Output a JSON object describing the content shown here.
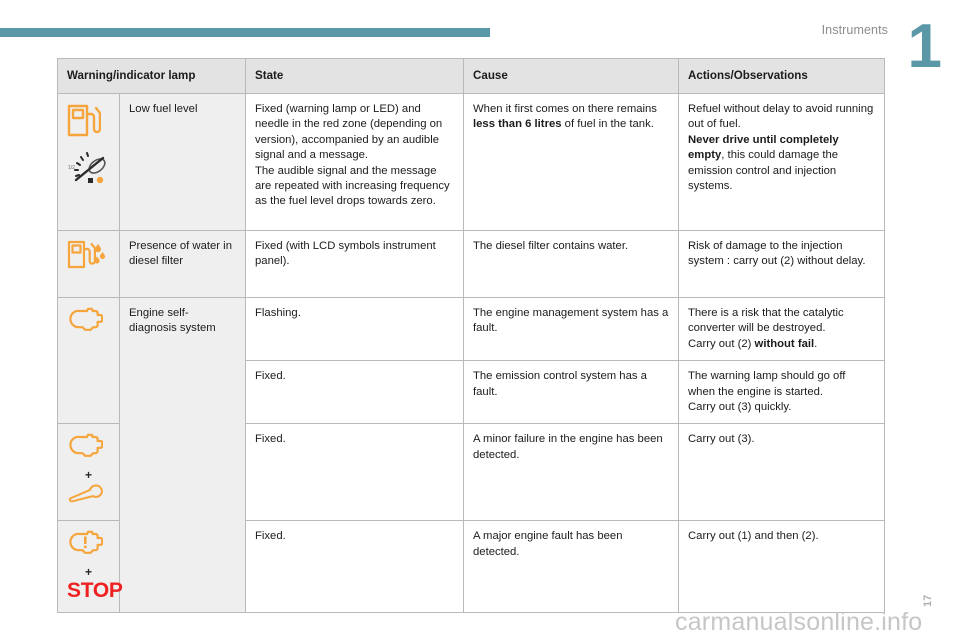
{
  "header": {
    "chapter_title": "Instruments",
    "chapter_number": "1"
  },
  "table": {
    "columns": [
      "Warning/indicator lamp",
      "State",
      "Cause",
      "Actions/Observations"
    ],
    "rows": [
      {
        "id": "low-fuel-level",
        "icons": [
          "fuel-pump-icon",
          "fuel-gauge-needle-icon"
        ],
        "name": "Low fuel level",
        "state": "Fixed (warning lamp or LED) and needle in the red zone (depending on version), accompanied by an audible signal and a message.\nThe audible signal and the message are repeated with increasing frequency as the fuel level drops towards zero.",
        "cause_pre": "When it first comes on there remains ",
        "cause_bold": "less than 6 litres",
        "cause_post": " of fuel in the tank.",
        "action_pre": "Refuel without delay to avoid running out of fuel.\n",
        "action_bold": "Never drive until completely empty",
        "action_post": ", this could damage the emission control and injection systems."
      },
      {
        "id": "water-in-diesel-filter",
        "icons": [
          "fuel-pump-water-drops-icon"
        ],
        "name": "Presence of water in diesel filter",
        "state": "Fixed (with LCD symbols instrument panel).",
        "cause": "The diesel filter contains water.",
        "action": "Risk of damage to the injection system : carry out (2) without delay."
      },
      {
        "id": "engine-self-diagnosis-flashing",
        "icons": [
          "check-engine-icon"
        ],
        "name": "Engine self-diagnosis system",
        "state": "Flashing.",
        "cause": "The engine management system has a fault.",
        "action_pre": "There is a risk that the catalytic converter will be destroyed.\nCarry out (2) ",
        "action_bold": "without fail",
        "action_post": "."
      },
      {
        "id": "engine-self-diagnosis-fixed",
        "icons": [],
        "name": "",
        "state": "Fixed.",
        "cause": "The emission control system has a fault.",
        "action": "The warning lamp should go off when the engine is started.\nCarry out (3) quickly."
      },
      {
        "id": "minor-engine-failure",
        "icons": [
          "check-engine-icon",
          "plus-sign",
          "wrench-icon"
        ],
        "plus": "+",
        "name": "",
        "state": "Fixed.",
        "cause": "A minor failure in the engine has been detected.",
        "action": "Carry out (3)."
      },
      {
        "id": "major-engine-fault",
        "icons": [
          "check-engine-warning-icon",
          "plus-sign",
          "stop-label"
        ],
        "plus": "+",
        "stop_label": "STOP",
        "name": "",
        "state": "Fixed.",
        "cause": "A major engine fault has been detected.",
        "action": "Carry out (1) and then (2)."
      }
    ]
  },
  "footer": {
    "watermark": "carmanualsonline.info",
    "page_number": "17"
  },
  "colors": {
    "accent_teal": "#5b98a7",
    "icon_orange": "#f5a53c",
    "stop_red": "#ee2222",
    "header_row_bg": "#e3e3e3",
    "label_cell_bg": "#efefef"
  }
}
